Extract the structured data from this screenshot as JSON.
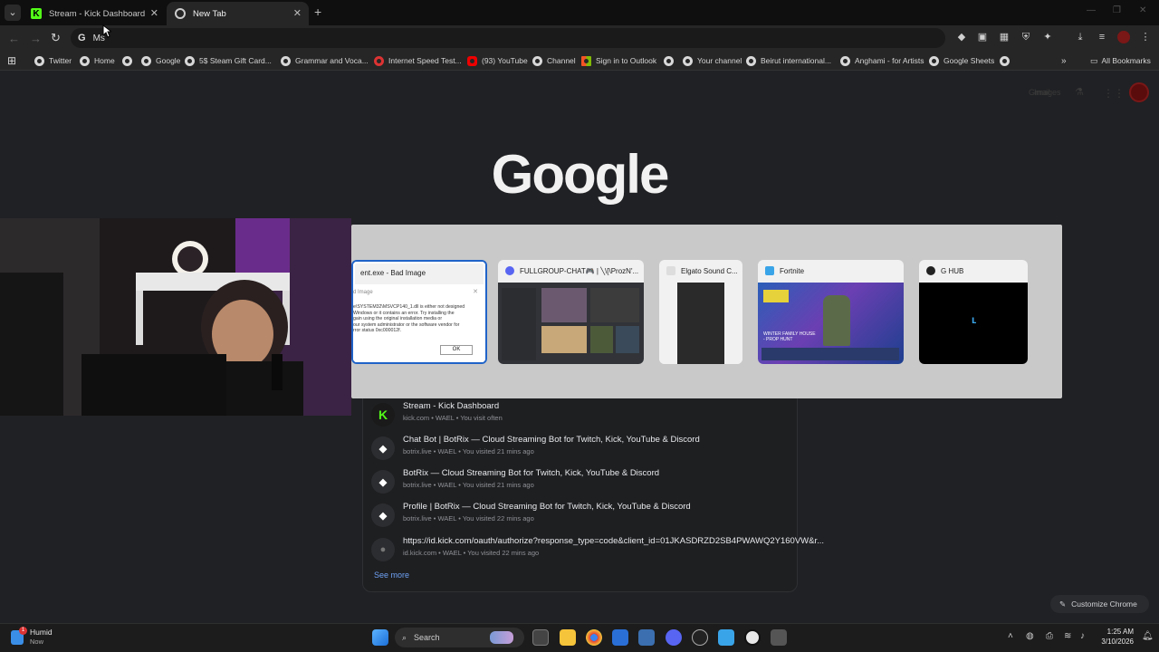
{
  "tabs": [
    {
      "label": "Stream - Kick Dashboard",
      "active": false
    },
    {
      "label": "New Tab",
      "active": true
    }
  ],
  "omnibox": {
    "value": "Ms"
  },
  "bookmarks": {
    "items": [
      "Twitter",
      "Home",
      "Google",
      "5$ Steam Gift Card...",
      "Grammar and Voca...",
      "Internet Speed Test...",
      "(93) YouTube",
      "Channel",
      "Sign in to Outlook",
      "Your channel",
      "Beirut international...",
      "Anghami - for Artists",
      "Google Sheets"
    ],
    "all_label": "All Bookmarks",
    "overflow_icon": "chevrons-right-icon"
  },
  "header_links": [
    "Gmail",
    "Images"
  ],
  "logo": "Google",
  "switcher": {
    "windows": [
      {
        "title": "ent.exe - Bad Image",
        "dialog_title": "d Image",
        "dialog_lines": [
          "e\\SYSTEM32\\MSVCP140_1.dll is either not designed",
          "Windows or it contains an error. Try installing the",
          "gain using the original installation media or",
          "our system administrator or the software vendor for",
          "rror status 0xc000012f."
        ],
        "ok": "OK",
        "selected": true
      },
      {
        "title": "FULLGROUP-CHAT🎮 | ╲\\[\\ProzN'...",
        "selected": false
      },
      {
        "title": "Elgato Sound C...",
        "selected": false
      },
      {
        "title": "Fortnite",
        "overlay_text": "WINTER FAMILY HOUSE - PROP HUNT",
        "selected": false
      },
      {
        "title": "G HUB",
        "selected": false
      }
    ]
  },
  "suggestions": [
    {
      "title": "Stream - Kick Dashboard",
      "meta": "kick.com • WAEL • You visit often",
      "icon": "kick-icon"
    },
    {
      "title": "Chat Bot | BotRix — Cloud Streaming Bot for Twitch, Kick, YouTube & Discord",
      "meta": "botrix.live • WAEL • You visited 21 mins ago",
      "icon": "botrix-icon"
    },
    {
      "title": "BotRix — Cloud Streaming Bot for Twitch, Kick, YouTube & Discord",
      "meta": "botrix.live • WAEL • You visited 21 mins ago",
      "icon": "botrix-icon"
    },
    {
      "title": "Profile | BotRix — Cloud Streaming Bot for Twitch, Kick, YouTube & Discord",
      "meta": "botrix.live • WAEL • You visited 22 mins ago",
      "icon": "botrix-icon"
    },
    {
      "title": "https://id.kick.com/oauth/authorize?response_type=code&client_id=01JKASDRZD2SB4PWAWQ2Y160VW&r...",
      "meta": "id.kick.com • WAEL • You visited 22 mins ago",
      "icon": "globe-icon"
    }
  ],
  "see_more": "See more",
  "customize": "Customize Chrome",
  "taskbar": {
    "weather_label": "Humid",
    "weather_sub": "Now",
    "weather_badge": "1",
    "search_placeholder": "Search",
    "time": "1:25 AM",
    "date": "3/10/2026"
  },
  "colors": {
    "accent": "#1f63c8",
    "kick_green": "#53fc18",
    "page_bg": "#202124",
    "link_blue": "#6ea0f2"
  }
}
